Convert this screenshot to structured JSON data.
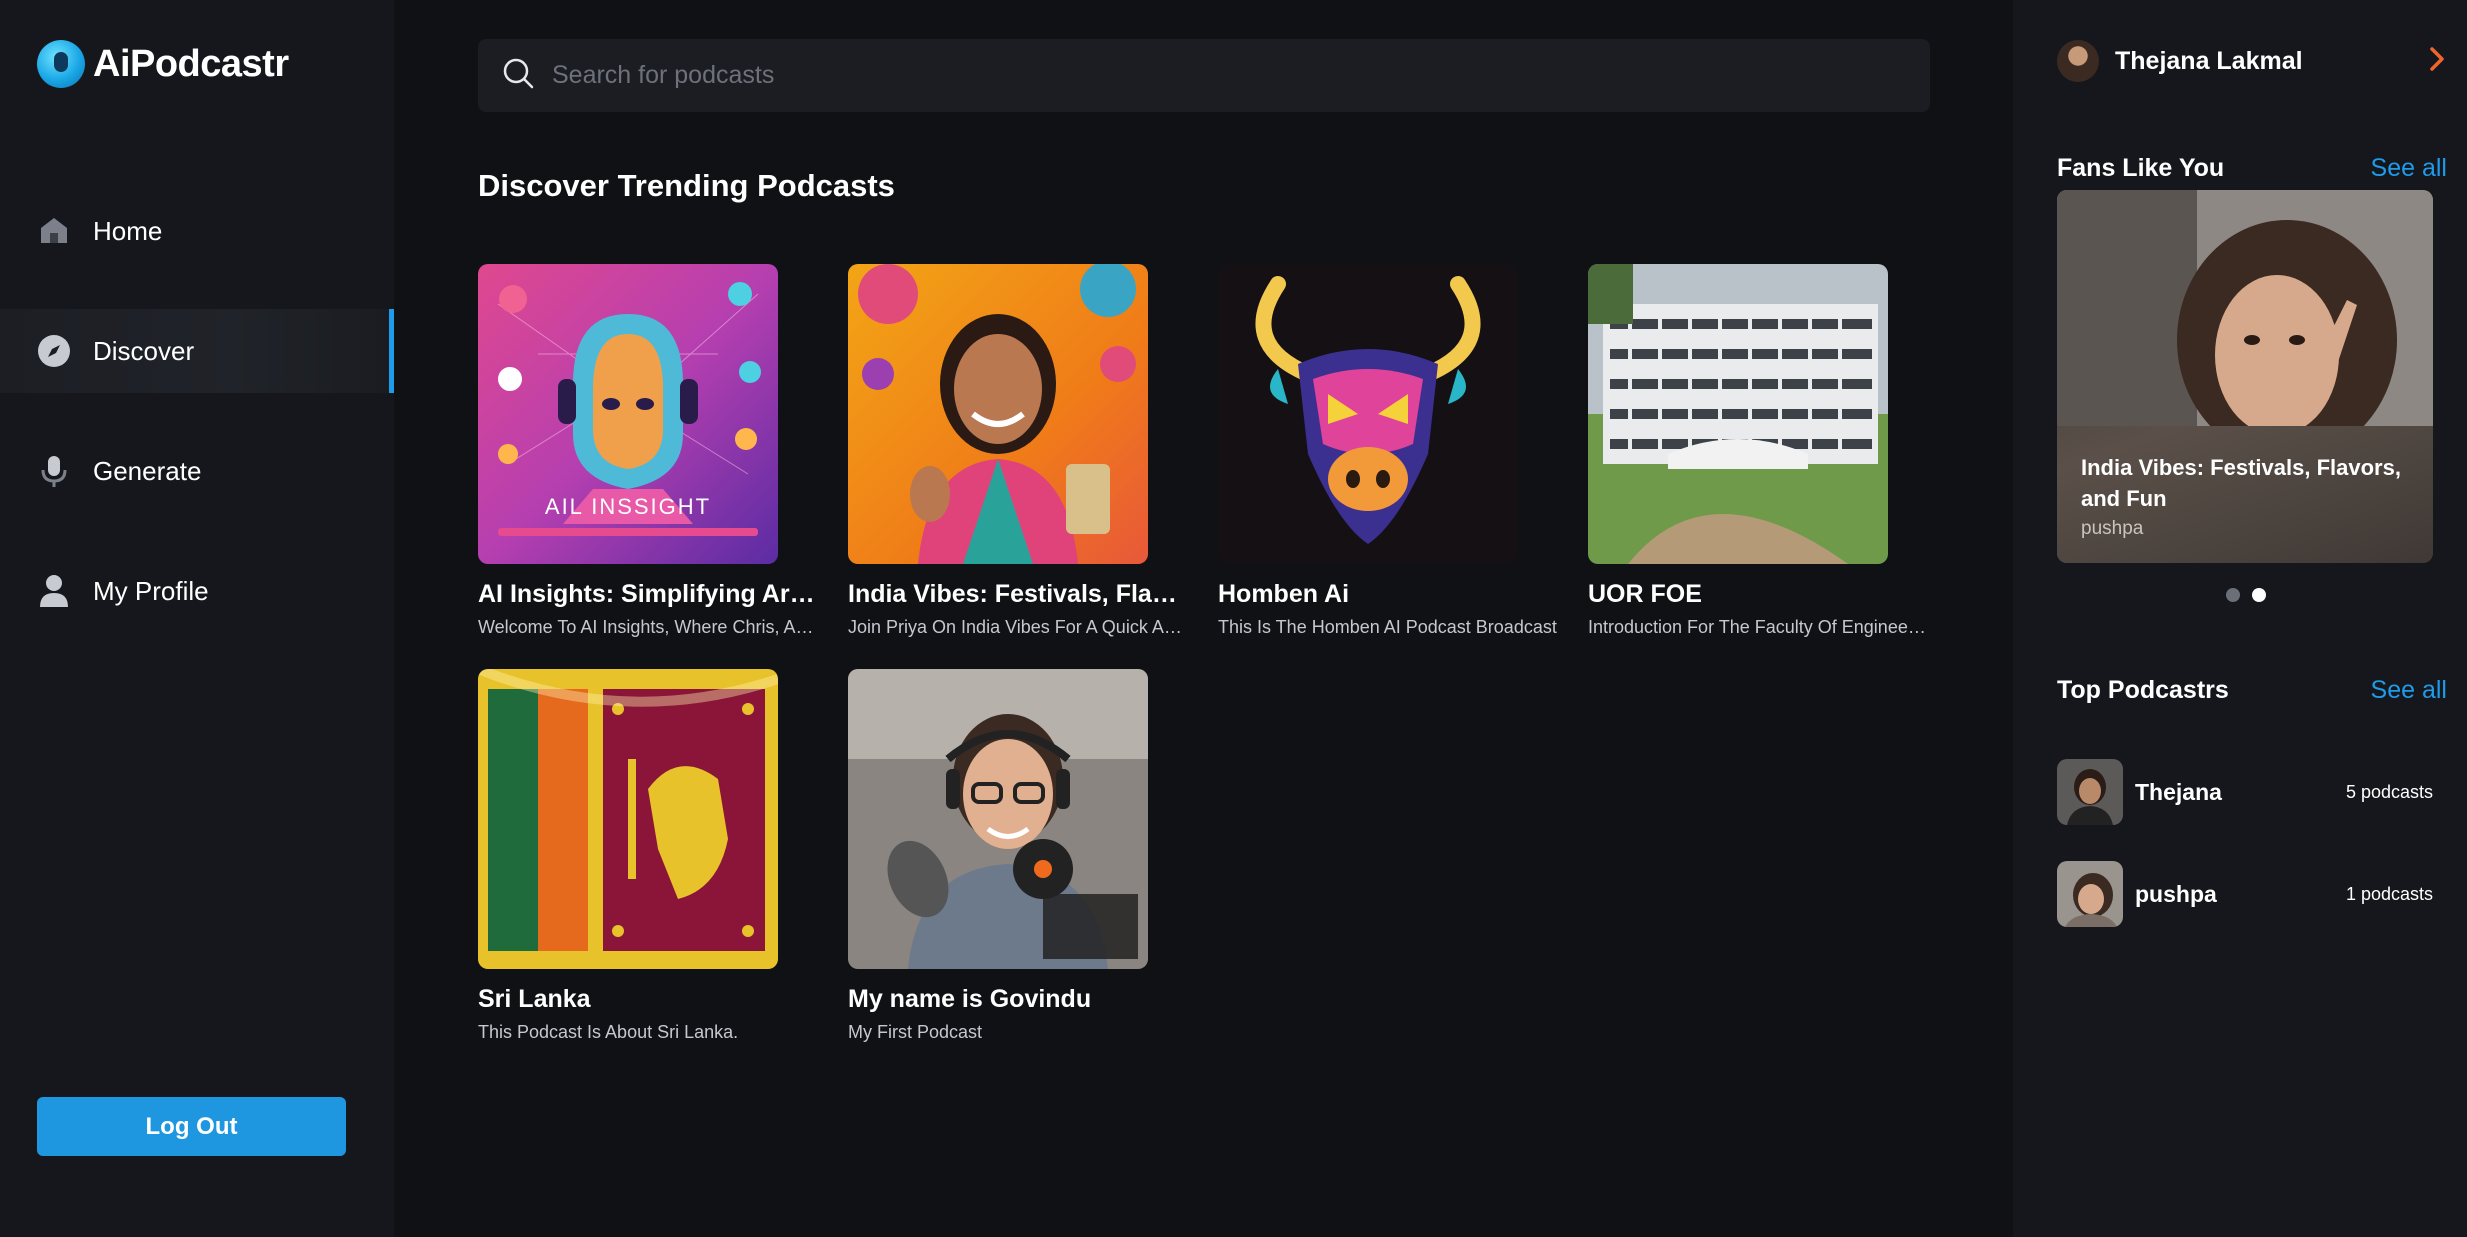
{
  "app": {
    "name": "AiPodcastr"
  },
  "nav": {
    "items": [
      {
        "label": "Home",
        "icon": "home-icon",
        "active": false
      },
      {
        "label": "Discover",
        "icon": "compass-icon",
        "active": true
      },
      {
        "label": "Generate",
        "icon": "microphone-icon",
        "active": false
      },
      {
        "label": "My Profile",
        "icon": "user-icon",
        "active": false
      }
    ],
    "logout_label": "Log Out"
  },
  "search": {
    "placeholder": "Search for podcasts",
    "value": ""
  },
  "main": {
    "section_title": "Discover Trending Podcasts",
    "podcasts": [
      {
        "title": "AI Insights: Simplifying Artificial Intelligence",
        "description": "Welcome To AI Insights, Where Chris, And Bella",
        "artwork_text": "AIL INSSIGHT"
      },
      {
        "title": "India Vibes: Festivals, Flavors, and Fun",
        "description": "Join Priya On India Vibes For A Quick And Fun Journey"
      },
      {
        "title": "Homben Ai",
        "description": "This Is The Homben AI Podcast Broadcast"
      },
      {
        "title": "UOR FOE",
        "description": "Introduction For The Faculty Of Engineering"
      },
      {
        "title": "Sri Lanka",
        "description": "This Podcast Is About Sri Lanka."
      },
      {
        "title": "My name is Govindu",
        "description": "My First Podcast"
      }
    ]
  },
  "right": {
    "user": {
      "name": "Thejana Lakmal"
    },
    "fans": {
      "heading": "Fans Like You",
      "see_all": "See all",
      "card": {
        "title": "India Vibes: Festivals, Flavors, and Fun",
        "author": "pushpa"
      },
      "slide_count": 2,
      "active_slide": 2
    },
    "top": {
      "heading": "Top Podcastrs",
      "see_all": "See all",
      "items": [
        {
          "name": "Thejana",
          "count": "5 podcasts"
        },
        {
          "name": "pushpa",
          "count": "1 podcasts"
        }
      ]
    }
  },
  "colors": {
    "accent": "#1e9be9",
    "background": "#101114",
    "panel": "#15171c",
    "arrow": "#f0642d"
  }
}
